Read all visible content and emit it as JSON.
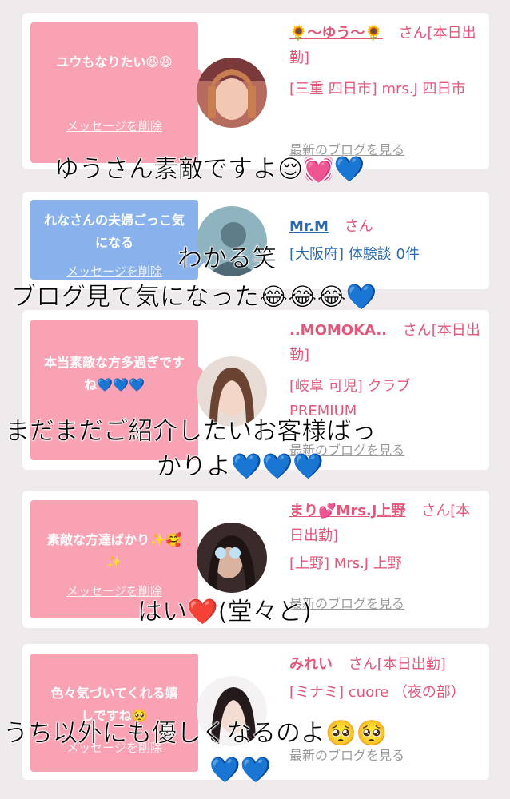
{
  "cards": [
    {
      "bubble_text": "ユウもなりたい😆😆",
      "delete_label": "メッセージを削除",
      "name": "🌻〜ゆう〜🌻",
      "honorific": "さん[本日出勤]",
      "location": "[三重 四日市] mrs.J 四日市",
      "blog_link": "最新のブログを見る"
    },
    {
      "bubble_text": "れなさんの夫婦ごっこ気になる",
      "delete_label": "メッセージを削除",
      "name": "Mr.M",
      "honorific": "さん",
      "location": "[大阪府] 体験談 0件"
    },
    {
      "bubble_text": "本当素敵な方多過ぎですね💙💙💙",
      "delete_label": "メッセージを削除",
      "name": "..MOMOKA..",
      "honorific": "さん[本日出勤]",
      "location": "[岐阜 可児] クラブ PREMIUM",
      "blog_link": "最新のブログを見る"
    },
    {
      "bubble_text": "素敵な方達ばかり✨🥰✨",
      "delete_label": "メッセージを削除",
      "name": "まり💕Mrs.J上野",
      "honorific": "さん[本日出勤]",
      "location": "[上野] Mrs.J 上野",
      "blog_link": "最新のブログを見る"
    },
    {
      "bubble_text": "色々気づいてくれる嬉しですね🥺",
      "delete_label": "メッセージを削除",
      "name": "みれい",
      "honorific": "さん[本日出勤]",
      "location": "[ミナミ] cuore （夜の部）",
      "blog_link": "最新のブログを見る"
    }
  ],
  "overlays": {
    "line1": "ゆうさん素敵ですよ😌💓💙",
    "line2": "わかる笑",
    "line3": "ブログ見て気になった😂😂😂💙",
    "line4": "まだまだご紹介したいお客様ばっ",
    "line5": "かりよ💙💙💙",
    "line6": "はい❤️(堂々と)",
    "line7": "うち以外にも優しくなるのよ🥺🥺",
    "line8": "💙💙"
  },
  "colors": {
    "bubble_pink": "#f8a2b3",
    "bubble_blue": "#89b2ec",
    "name_pink": "#e2577a",
    "name_blue": "#2a6ab0",
    "background": "#efeaec"
  }
}
